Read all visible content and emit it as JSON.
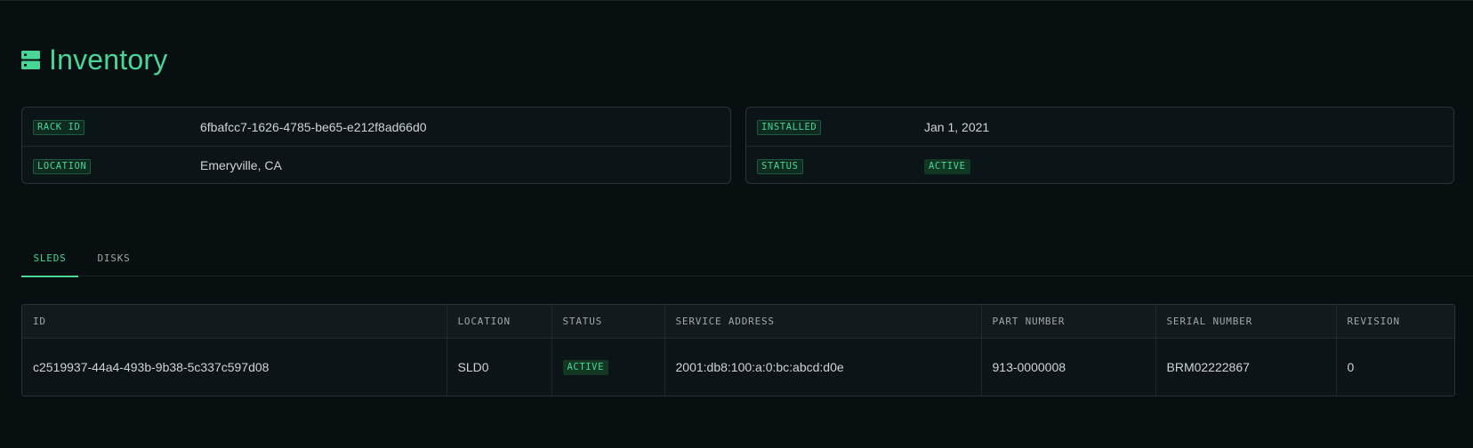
{
  "page": {
    "title": "Inventory",
    "icon": "servers-icon",
    "accent_color": "#48D597"
  },
  "properties_left": [
    {
      "key": "RACK ID",
      "value": "6fbafcc7-1626-4785-be65-e212f8ad66d0"
    },
    {
      "key": "LOCATION",
      "value": "Emeryville, CA"
    }
  ],
  "properties_right": [
    {
      "key": "INSTALLED",
      "value": "Jan 1, 2021"
    },
    {
      "key": "STATUS",
      "value": "ACTIVE"
    }
  ],
  "tabs": [
    {
      "label": "SLEDS",
      "active": true
    },
    {
      "label": "DISKS",
      "active": false
    }
  ],
  "sleds_table": {
    "columns": [
      "ID",
      "LOCATION",
      "STATUS",
      "SERVICE ADDRESS",
      "PART NUMBER",
      "SERIAL NUMBER",
      "REVISION"
    ],
    "rows": [
      {
        "id": "c2519937-44a4-493b-9b38-5c337c597d08",
        "location": "SLD0",
        "status": "ACTIVE",
        "service_address": "2001:db8:100:a:0:bc:abcd:d0e",
        "part_number": "913-0000008",
        "serial_number": "BRM02222867",
        "revision": "0"
      }
    ]
  }
}
